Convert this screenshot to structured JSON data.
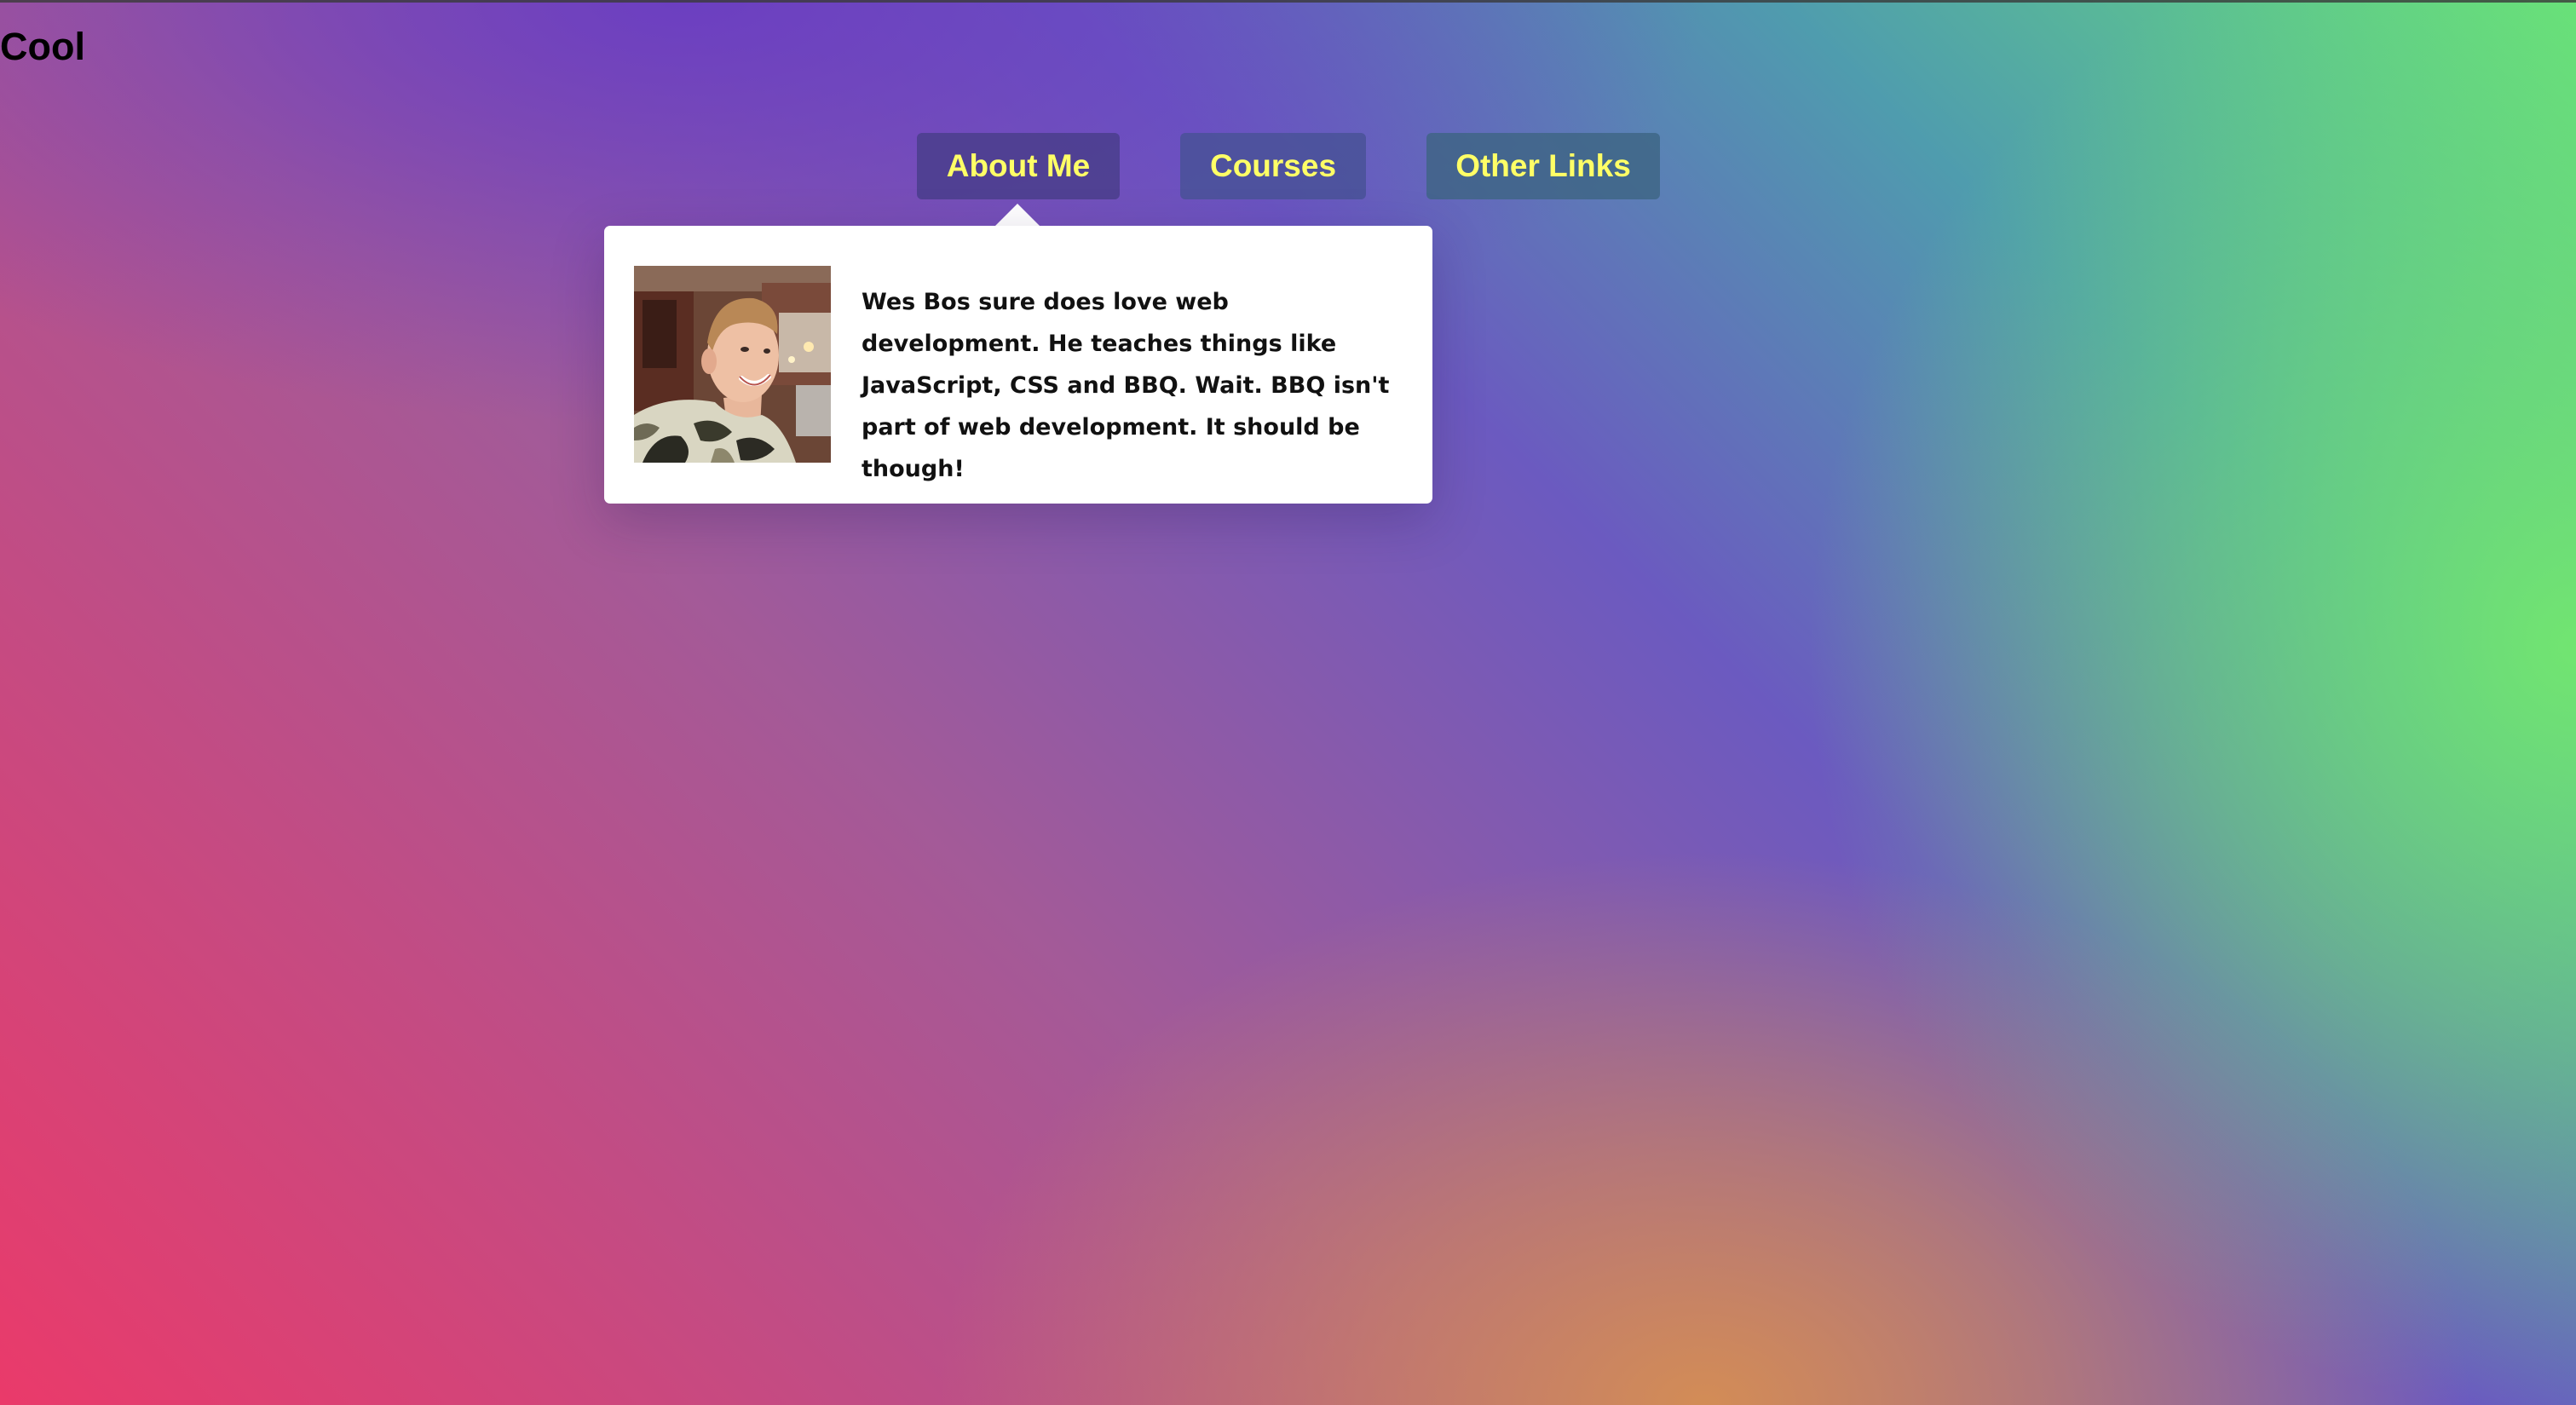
{
  "header": {
    "title": "Cool"
  },
  "nav": {
    "items": [
      {
        "label": "About Me"
      },
      {
        "label": "Courses"
      },
      {
        "label": "Other Links"
      }
    ]
  },
  "dropdown": {
    "bio": "Wes Bos sure does love web development. He teaches things like JavaScript, CSS and BBQ. Wait. BBQ isn't part of web development. It should be though!"
  },
  "colors": {
    "nav_text": "#ffff66",
    "dropdown_bg": "#ffffff",
    "gradient_corner_bottom_left": "#ea3a6a",
    "gradient_corner_top": "#6b5ac0",
    "gradient_corner_right": "#67e07a",
    "gradient_bottom_center": "#d68f52"
  }
}
